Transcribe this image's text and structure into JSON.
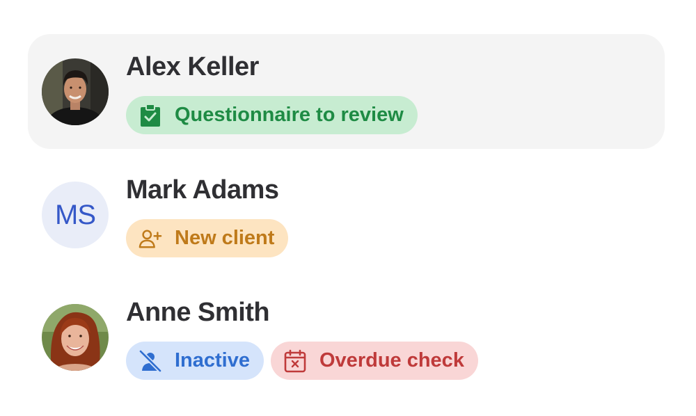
{
  "clients": [
    {
      "name": "Alex Keller",
      "avatar": "photo-man",
      "selected": true,
      "tags": [
        {
          "label": "Questionnaire to review",
          "icon": "clipboard-check-icon",
          "color": "#1e8b44",
          "bg": "#c7ecd1"
        }
      ]
    },
    {
      "name": "Mark Adams",
      "avatar_initials": "MS",
      "selected": false,
      "tags": [
        {
          "label": "New client",
          "icon": "user-plus-icon",
          "color": "#bf7a1a",
          "bg": "#fde4c1"
        }
      ]
    },
    {
      "name": "Anne Smith",
      "avatar": "photo-woman",
      "selected": false,
      "tags": [
        {
          "label": "Inactive",
          "icon": "user-off-icon",
          "color": "#2f6ed0",
          "bg": "#d5e4fb"
        },
        {
          "label": "Overdue check",
          "icon": "calendar-x-icon",
          "color": "#bf3a3a",
          "bg": "#f9d6d6"
        }
      ]
    }
  ]
}
